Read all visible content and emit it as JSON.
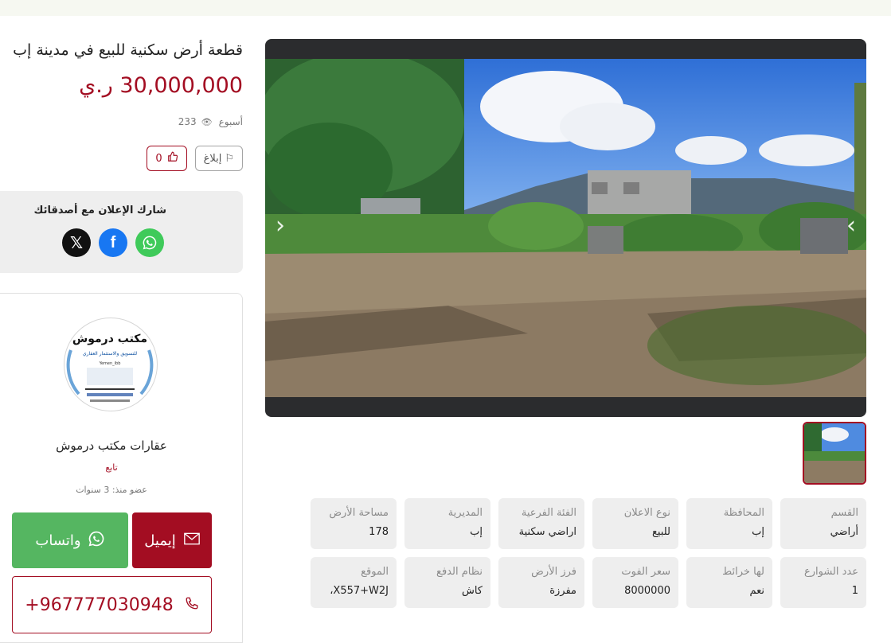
{
  "listing": {
    "title": "قطعة أرض سكنية للبيع في مدينة إب",
    "price": "30,000,000 ر.ي",
    "posted": "أسبوع",
    "views": "233",
    "report_label": "إبلاغ",
    "likes": "0"
  },
  "share": {
    "title": "شارك الإعلان مع أصدقائك",
    "icons": [
      "whatsapp-icon",
      "facebook-icon",
      "x-icon"
    ]
  },
  "agent": {
    "logo_text": "مكتب درموش",
    "logo_subtitle": "للتسويق والاستثمار العقاري",
    "logo_handle": "Yemen_ibb",
    "name": "عقارات مكتب درموش",
    "follow_label": "تابع",
    "member_since": "عضو منذ: 3 سنوات"
  },
  "contact": {
    "whatsapp_label": "واتساب",
    "email_label": "إيميل",
    "phone": "+967777030948"
  },
  "specs": [
    {
      "key": "القسم",
      "value": "أراضي"
    },
    {
      "key": "المحافظة",
      "value": "إب"
    },
    {
      "key": "نوع الاعلان",
      "value": "للبيع"
    },
    {
      "key": "الفئة الفرعية",
      "value": "اراضي سكنية"
    },
    {
      "key": "المديرية",
      "value": "إب"
    },
    {
      "key": "مساحة الأرض",
      "value": "178"
    },
    {
      "key": "عدد الشوارع",
      "value": "1"
    },
    {
      "key": "لها خرائط",
      "value": "نعم"
    },
    {
      "key": "سعر الفوت",
      "value": "8000000"
    },
    {
      "key": "فرز الأرض",
      "value": "مفرزة"
    },
    {
      "key": "نظام الدفع",
      "value": "كاش"
    },
    {
      "key": "الموقع",
      "value": "X557+W2J،"
    }
  ],
  "colors": {
    "accent": "#a30d22",
    "whatsapp": "#55b661",
    "facebook": "#1877f2"
  }
}
